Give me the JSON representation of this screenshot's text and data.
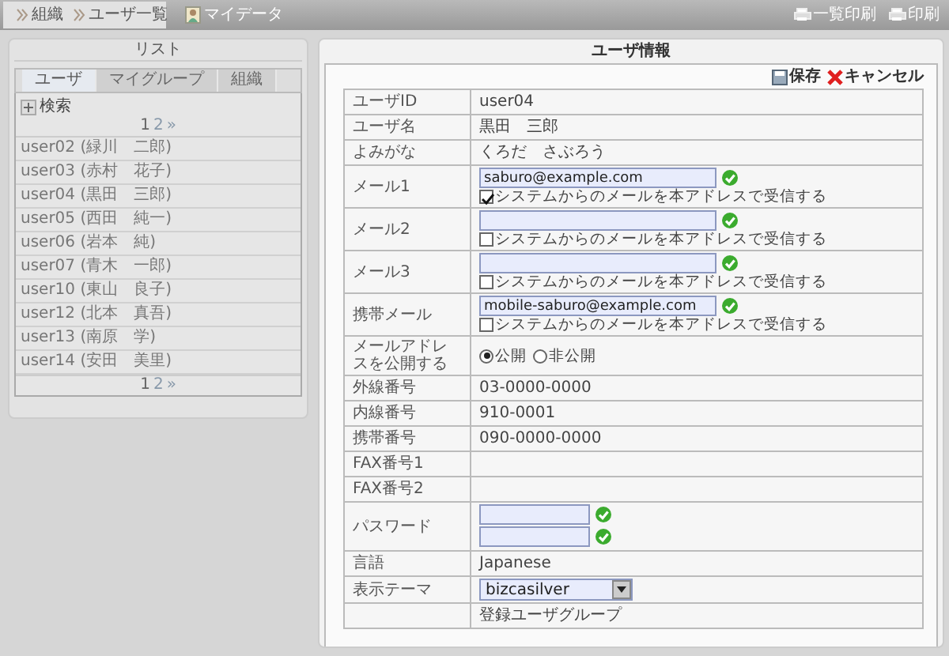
{
  "topbar": {
    "breadcrumb": [
      {
        "label": "組織"
      },
      {
        "label": "ユーザ一覧"
      }
    ],
    "mydata": "マイデータ",
    "actions": [
      {
        "label": "一覧印刷"
      },
      {
        "label": "印刷"
      }
    ]
  },
  "list_panel": {
    "title": "リスト",
    "tabs": [
      {
        "label": "ユーザ",
        "selected": true
      },
      {
        "label": "マイグループ",
        "selected": false
      },
      {
        "label": "組織",
        "selected": false
      }
    ],
    "search": "検索",
    "pager_top": {
      "pages": [
        {
          "label": "1",
          "selected": true
        },
        {
          "label": "2",
          "selected": false
        }
      ],
      "next": "»"
    },
    "users": [
      "user02 (緑川　二郎)",
      "user03 (赤村　花子)",
      "user04 (黒田　三郎)",
      "user05 (西田　純一)",
      "user06 (岩本　純)",
      "user07 (青木　一郎)",
      "user10 (東山　良子)",
      "user12 (北本　真吾)",
      "user13 (南原　学)",
      "user14 (安田　美里)"
    ],
    "pager_bottom": {
      "pages": [
        {
          "label": "1",
          "selected": true
        },
        {
          "label": "2",
          "selected": false
        }
      ],
      "next": "»"
    }
  },
  "detail": {
    "title": "ユーザ情報",
    "save": "保存",
    "cancel": "キャンセル",
    "rows": [
      {
        "kind": "text",
        "label": "ユーザID",
        "value": "user04"
      },
      {
        "kind": "text",
        "label": "ユーザ名",
        "value": "黒田　三郎"
      },
      {
        "kind": "text",
        "label": "よみがな",
        "value": "くろだ　さぶろう"
      },
      {
        "kind": "email",
        "label": "メール1",
        "value": "saburo@example.com",
        "checked": true,
        "option": "システムからのメールを本アドレスで受信する"
      },
      {
        "kind": "email",
        "label": "メール2",
        "checked": false,
        "option": "システムからのメールを本アドレスで受信する"
      },
      {
        "kind": "email",
        "label": "メール3",
        "checked": false,
        "option": "システムからのメールを本アドレスで受信する"
      },
      {
        "kind": "email",
        "label": "携帯メール",
        "value": "mobile-saburo@example.com",
        "checked": false,
        "option": "システムからのメールを本アドレスで受信する"
      },
      {
        "kind": "radio",
        "label": "メールアドレスを公開する",
        "options": [
          {
            "label": "公開",
            "selected": true
          },
          {
            "label": "非公開",
            "selected": false
          }
        ]
      },
      {
        "kind": "text",
        "label": "外線番号",
        "value": "03-0000-0000"
      },
      {
        "kind": "text",
        "label": "内線番号",
        "value": "910-0001"
      },
      {
        "kind": "text",
        "label": "携帯番号",
        "value": "090-0000-0000"
      },
      {
        "kind": "text",
        "label": "FAX番号1"
      },
      {
        "kind": "text",
        "label": "FAX番号2"
      },
      {
        "kind": "password",
        "label": "パスワード"
      },
      {
        "kind": "text",
        "label": "言語",
        "value": "Japanese"
      },
      {
        "kind": "select",
        "label": "表示テーマ",
        "value": "bizcasilver"
      },
      {
        "kind": "text",
        "value": "登録ユーザグループ"
      }
    ]
  }
}
